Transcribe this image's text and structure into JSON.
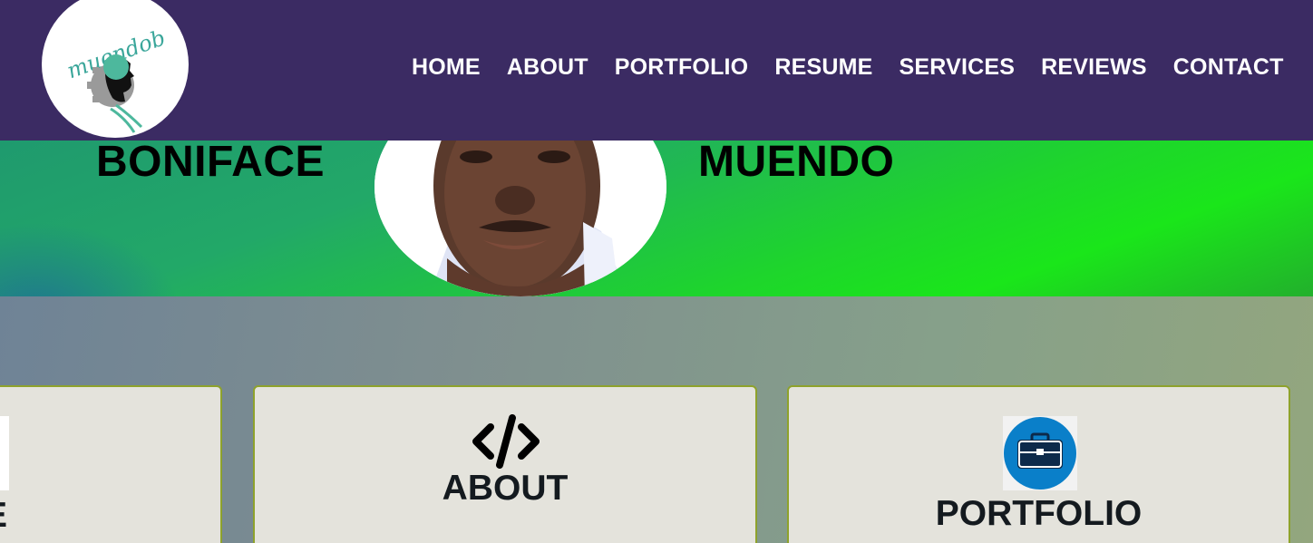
{
  "logo": {
    "text": "muendob",
    "icon": "gear-head-logo-icon"
  },
  "nav": {
    "items": [
      {
        "label": "HOME"
      },
      {
        "label": "ABOUT"
      },
      {
        "label": "PORTFOLIO"
      },
      {
        "label": "RESUME"
      },
      {
        "label": "SERVICES"
      },
      {
        "label": "REVIEWS"
      },
      {
        "label": "CONTACT"
      }
    ]
  },
  "hero": {
    "first_name": "BONIFACE",
    "last_name": "MUENDO",
    "portrait": "profile-portrait"
  },
  "cards": [
    {
      "title": "E",
      "icon": "globe-icon"
    },
    {
      "title": "ABOUT",
      "icon": "code-icon"
    },
    {
      "title": "PORTFOLIO",
      "icon": "briefcase-icon"
    }
  ],
  "colors": {
    "navbar": "#3b2b63",
    "nav_text": "#ffffff",
    "hero_green": "#1ae61a",
    "card_bg": "#e4e3dc",
    "card_border": "#8ea22c",
    "briefcase_blue": "#0a7fc9"
  }
}
